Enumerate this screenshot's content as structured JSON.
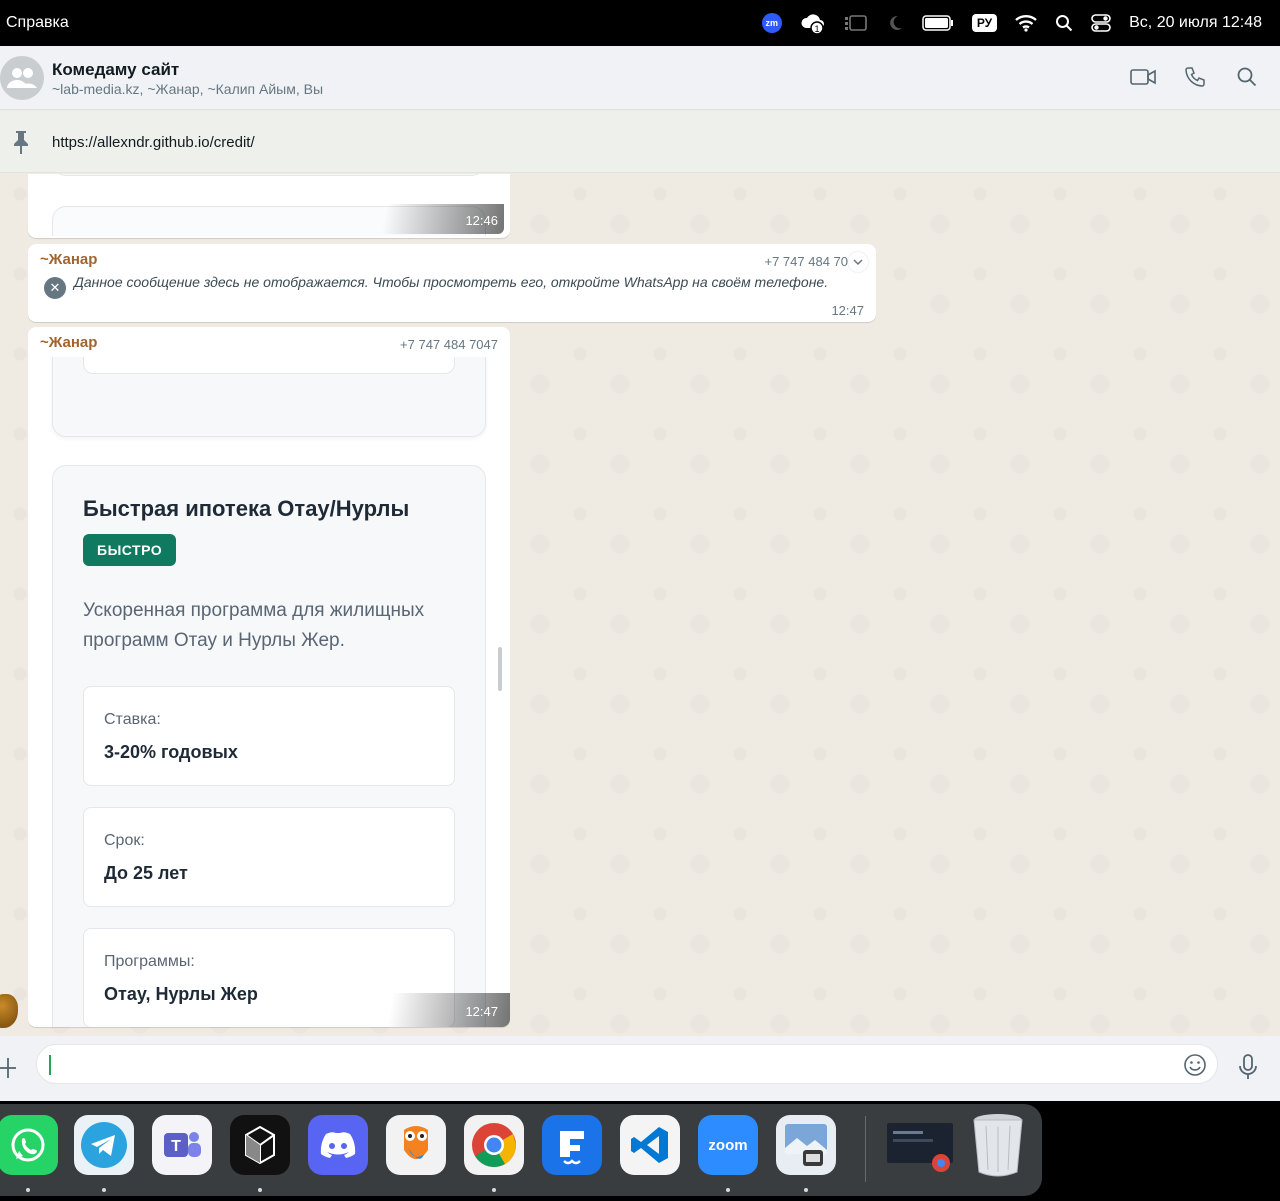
{
  "menubar": {
    "app_menu": "Справка",
    "zoom_badge": "zm",
    "notification_count": "1",
    "language": "РУ",
    "datetime": "Вс, 20 июля  12:48"
  },
  "chat": {
    "title": "Комедаму сайт",
    "participants": "~lab-media.kz, ~Жанар, ~Калип Айым, Вы"
  },
  "pinned": {
    "link": "https://allexndr.github.io/credit/"
  },
  "messages": [
    {
      "time": "12:46"
    },
    {
      "sender": "~Жанар",
      "phone": "+7 747 484 70",
      "text": "Данное сообщение здесь не отображается. Чтобы просмотреть его, откройте WhatsApp на своём телефоне.",
      "time": "12:47"
    },
    {
      "sender": "~Жанар",
      "phone": "+7 747 484 7047",
      "time": "12:47",
      "card": {
        "title": "Быстрая ипотека Отау/Нурлы",
        "badge": "БЫСТРО",
        "description": "Ускоренная программа для жилищных программ Отау и Нурлы Жер.",
        "params": [
          {
            "label": "Ставка:",
            "value": "3-20% годовых"
          },
          {
            "label": "Срок:",
            "value": "До 25 лет"
          },
          {
            "label": "Программы:",
            "value": "Отау, Нурлы Жер"
          }
        ]
      }
    }
  ],
  "dock": {
    "zoom_label": "zoom",
    "apps": [
      "whatsapp-icon",
      "telegram-icon",
      "teams-icon",
      "perplexity-icon",
      "discord-icon",
      "owl-icon",
      "chrome-icon",
      "wps-icon",
      "vscode-icon",
      "zoom-icon",
      "preview-icon",
      "screenshot-icon",
      "trash-icon"
    ]
  },
  "colors": {
    "accent_green": "#0f7a5f",
    "sender_color": "#a2642b",
    "chat_bg": "#efeae2"
  }
}
